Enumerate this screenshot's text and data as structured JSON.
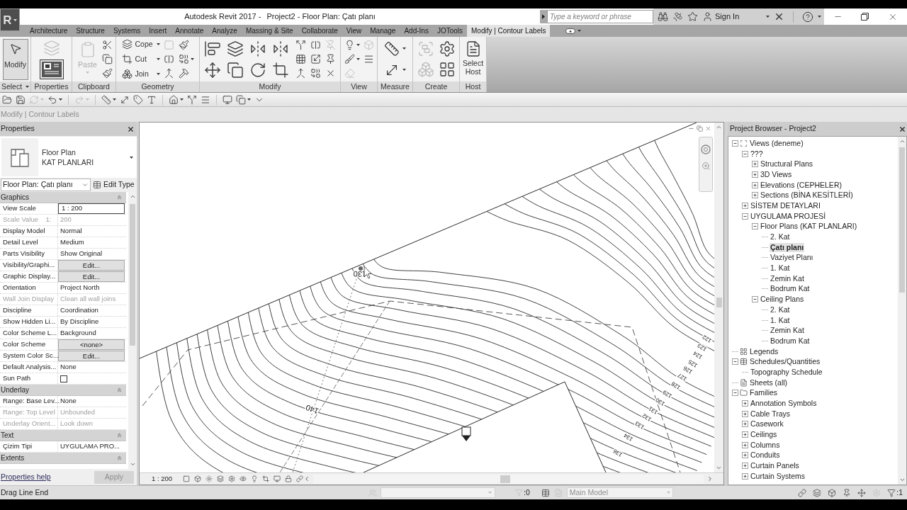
{
  "title_bar": {
    "app_button": "R",
    "app_title": "Autodesk Revit 2017 -",
    "document_title": "Project2 - Floor Plan: Çatı planı",
    "search": {
      "placeholder": "Type a keyword or phrase"
    },
    "sign_in": "Sign In"
  },
  "ribbon_tabs": [
    {
      "label": "Architecture",
      "selected": false
    },
    {
      "label": "Structure",
      "selected": false
    },
    {
      "label": "Systems",
      "selected": false
    },
    {
      "label": "Insert",
      "selected": false
    },
    {
      "label": "Annotate",
      "selected": false
    },
    {
      "label": "Analyze",
      "selected": false
    },
    {
      "label": "Massing & Site",
      "selected": false
    },
    {
      "label": "Collaborate",
      "selected": false
    },
    {
      "label": "View",
      "selected": false
    },
    {
      "label": "Manage",
      "selected": false
    },
    {
      "label": "Add-Ins",
      "selected": false
    },
    {
      "label": "JOTools",
      "selected": false
    },
    {
      "label": "Modify | Contour Labels",
      "selected": true
    }
  ],
  "ribbon_panels": [
    {
      "label": "Select",
      "tools": [
        {
          "label": "Modify",
          "selected": true
        }
      ]
    },
    {
      "label": "Properties",
      "tools": [
        {
          "disabled": true
        },
        {
          "disabled": false
        }
      ]
    },
    {
      "label": "Clipboard",
      "tools": [
        {
          "label": "Paste",
          "disabled": true
        },
        {
          "disabled": false
        },
        {
          "disabled": false
        },
        {
          "disabled": false
        }
      ]
    },
    {
      "label": "Geometry",
      "tools": [
        {
          "label": "Cope",
          "disabled": false
        },
        {
          "label": "Cut",
          "disabled": false
        },
        {
          "label": "Join",
          "disabled": false
        },
        {
          "disabled": true
        },
        {
          "disabled": false
        },
        {
          "disabled": false
        },
        {
          "disabled": false
        },
        {
          "disabled": false
        },
        {
          "disabled": false
        }
      ]
    },
    {
      "label": "Modify",
      "tools": [
        {
          "disabled": false
        },
        {
          "disabled": false
        },
        {
          "disabled": false
        },
        {
          "disabled": false
        },
        {
          "disabled": false
        },
        {
          "disabled": false
        },
        {
          "disabled": false
        },
        {
          "disabled": false
        },
        {
          "disabled": false
        },
        {
          "disabled": false
        },
        {
          "disabled": true
        },
        {
          "disabled": false
        },
        {
          "disabled": false
        },
        {
          "disabled": false
        },
        {
          "disabled": false
        },
        {
          "disabled": false
        },
        {
          "disabled": false
        }
      ]
    },
    {
      "label": "View",
      "tools": [
        {
          "disabled": false
        },
        {
          "disabled": true
        },
        {
          "disabled": false
        },
        {
          "disabled": false
        },
        {
          "disabled": true
        }
      ]
    },
    {
      "label": "Measure",
      "tools": [
        {
          "disabled": false
        },
        {
          "disabled": false
        }
      ]
    },
    {
      "label": "Create",
      "tools": [
        {
          "disabled": true
        },
        {
          "disabled": false
        },
        {
          "disabled": true
        },
        {
          "disabled": false
        }
      ]
    },
    {
      "label": "Host",
      "tools": [
        {
          "label": "Select Host",
          "disabled": false
        }
      ]
    }
  ],
  "quick_access": [
    {
      "disabled": false
    },
    {
      "disabled": false
    },
    {
      "disabled": true
    },
    {
      "disabled": false
    },
    {
      "disabled": true
    },
    {
      "disabled": false
    },
    {
      "disabled": false
    },
    {
      "disabled": false
    },
    {
      "disabled": false
    },
    {
      "disabled": false
    },
    {
      "disabled": false
    },
    {
      "disabled": false
    },
    {
      "disabled": false
    },
    {
      "disabled": false
    },
    {
      "disabled": false
    }
  ],
  "options_bar": {
    "label": "Modify | Contour Labels",
    "disabled": true
  },
  "properties": {
    "title": "Properties",
    "type_selector": {
      "family": "Floor Plan",
      "type": "KAT PLANLARI"
    },
    "instance": "Floor Plan: Çatı planı",
    "edit_type": "Edit Type",
    "groups": [
      {
        "label": "Graphics",
        "rows": [
          {
            "name": "View Scale",
            "value": "1 : 200",
            "kind": "field",
            "disabled": false
          },
          {
            "name": "Scale Value    1:",
            "value": "200",
            "kind": "text",
            "disabled": true
          },
          {
            "name": "Display Model",
            "value": "Normal",
            "kind": "text",
            "disabled": false
          },
          {
            "name": "Detail Level",
            "value": "Medium",
            "kind": "text",
            "disabled": false
          },
          {
            "name": "Parts Visibility",
            "value": "Show Original",
            "kind": "text",
            "disabled": false
          },
          {
            "name": "Visibility/Graphi...",
            "value": "Edit...",
            "kind": "button",
            "disabled": false
          },
          {
            "name": "Graphic Display...",
            "value": "Edit...",
            "kind": "button",
            "disabled": false
          },
          {
            "name": "Orientation",
            "value": "Project North",
            "kind": "text",
            "disabled": false
          },
          {
            "name": "Wall Join Display",
            "value": "Clean all wall joins",
            "kind": "text",
            "disabled": true
          },
          {
            "name": "Discipline",
            "value": "Coordination",
            "kind": "text",
            "disabled": false
          },
          {
            "name": "Show Hidden Li...",
            "value": "By Discipline",
            "kind": "text",
            "disabled": false
          },
          {
            "name": "Color Scheme L...",
            "value": "Background",
            "kind": "text",
            "disabled": false
          },
          {
            "name": "Color Scheme",
            "value": "<none>",
            "kind": "button",
            "disabled": false
          },
          {
            "name": "System Color Sc...",
            "value": "Edit...",
            "kind": "button",
            "disabled": false
          },
          {
            "name": "Default Analysis...",
            "value": "None",
            "kind": "text",
            "disabled": false
          },
          {
            "name": "Sun Path",
            "kind": "checkbox",
            "checked": false,
            "disabled": false
          }
        ]
      },
      {
        "label": "Underlay",
        "rows": [
          {
            "name": "Range: Base Lev...",
            "value": "None",
            "kind": "text",
            "disabled": false
          },
          {
            "name": "Range: Top Level",
            "value": "Unbounded",
            "kind": "text",
            "disabled": true
          },
          {
            "name": "Underlay Orient...",
            "value": "Look down",
            "kind": "text",
            "disabled": true
          }
        ]
      },
      {
        "label": "Text",
        "rows": [
          {
            "name": "Çizim Tipi",
            "value": "UYGULAMA PRO...",
            "kind": "text",
            "disabled": false
          }
        ]
      },
      {
        "label": "Extents"
      }
    ],
    "help_link": "Properties help",
    "apply": {
      "label": "Apply",
      "disabled": true
    }
  },
  "canvas": {
    "contour_labels": [
      "130",
      "140",
      "122",
      "123",
      "124",
      "125",
      "126",
      "127",
      "128",
      "129",
      "130",
      "131",
      "132",
      "133",
      "134",
      "136"
    ],
    "view_scale": "1 : 200"
  },
  "project_browser": {
    "title": "Project Browser - Project2",
    "tree": [
      {
        "label": "Views (deneme)",
        "kind": "views",
        "expanded": true,
        "selected": false,
        "children": [
          {
            "label": "???",
            "expanded": true,
            "selected": false,
            "children": [
              {
                "label": "Structural Plans",
                "expanded": false,
                "selected": false
              },
              {
                "label": "3D Views",
                "expanded": false,
                "selected": false
              },
              {
                "label": "Elevations (CEPHELER)",
                "expanded": false,
                "selected": false
              },
              {
                "label": "Sections (BİNA KESİTLERİ)",
                "expanded": false,
                "selected": false
              }
            ]
          },
          {
            "label": "SİSTEM DETAYLARI",
            "expanded": false,
            "selected": false
          },
          {
            "label": "UYGULAMA PROJESİ",
            "expanded": true,
            "selected": false,
            "children": [
              {
                "label": "Floor Plans (KAT PLANLARI)",
                "expanded": true,
                "selected": false,
                "children": [
                  {
                    "label": "2. Kat",
                    "selected": false
                  },
                  {
                    "label": "Çatı planı",
                    "selected": true
                  },
                  {
                    "label": "Vaziyet Planı",
                    "selected": false
                  },
                  {
                    "label": "1. Kat",
                    "selected": false
                  },
                  {
                    "label": "Zemin Kat",
                    "selected": false
                  },
                  {
                    "label": "Bodrum Kat",
                    "selected": false
                  }
                ]
              },
              {
                "label": "Ceiling Plans",
                "expanded": true,
                "selected": false,
                "children": [
                  {
                    "label": "2. Kat",
                    "selected": false
                  },
                  {
                    "label": "1. Kat",
                    "selected": false
                  },
                  {
                    "label": "Zemin Kat",
                    "selected": false
                  },
                  {
                    "label": "Bodrum Kat",
                    "selected": false
                  }
                ]
              }
            ]
          }
        ]
      },
      {
        "label": "Legends",
        "kind": "legends",
        "selected": false
      },
      {
        "label": "Schedules/Quantities",
        "kind": "schedules",
        "expanded": true,
        "selected": false,
        "children": [
          {
            "label": "Topography Schedule",
            "selected": false
          }
        ]
      },
      {
        "label": "Sheets (all)",
        "kind": "sheets",
        "selected": false
      },
      {
        "label": "Families",
        "kind": "families",
        "expanded": true,
        "selected": false,
        "children": [
          {
            "label": "Annotation Symbols",
            "expanded": false,
            "selected": false
          },
          {
            "label": "Cable Trays",
            "expanded": false,
            "selected": false
          },
          {
            "label": "Casework",
            "expanded": false,
            "selected": false
          },
          {
            "label": "Ceilings",
            "expanded": false,
            "selected": false
          },
          {
            "label": "Columns",
            "expanded": false,
            "selected": false
          },
          {
            "label": "Conduits",
            "expanded": false,
            "selected": false
          },
          {
            "label": "Curtain Panels",
            "expanded": false,
            "selected": false
          },
          {
            "label": "Curtain Systems",
            "expanded": false,
            "selected": false
          }
        ]
      }
    ]
  },
  "status_bar": {
    "message": "Drag Line End",
    "workset_field": {
      "disabled": true
    },
    "editable_count": ":0",
    "design_option": {
      "label": "Main Model",
      "disabled": true
    },
    "filter_count": ":1"
  }
}
